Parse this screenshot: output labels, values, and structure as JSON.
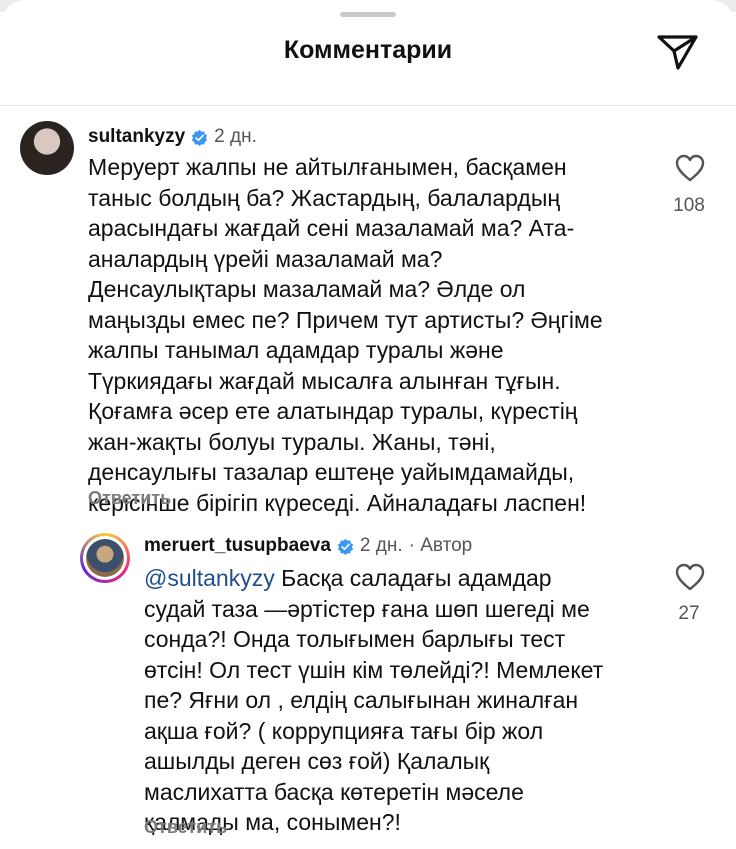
{
  "header": {
    "title": "Комментарии"
  },
  "comments": [
    {
      "username": "sultankyzy",
      "time": "2 дн.",
      "text": "Меруерт жалпы не айтылғанымен, басқамен\nтаныс болдың ба? Жастардың, балалардың\nарасындағы жағдай сені мазаламай ма? Ата-\nаналардың үрейі мазаламай ма?\nДенсаулықтары мазаламай ма? Әлде ол\nмаңызды емес пе? Причем тут артисты? Әңгіме\nжалпы танымал адамдар туралы және\nТүркиядағы жағдай мысалға алынған тұғын.\nҚоғамға әсер ете алатындар туралы, күрестің\nжан-жақты болуы туралы. Жаны, тәні,\nденсаулығы тазалар ештеңе уайымдамайды,\nкерісінше бірігіп күреседі. Айналадағы ласпен!",
      "likes": "108",
      "reply_label": "Ответить"
    },
    {
      "username": "meruert_tusupbaeva",
      "time": "2 дн.",
      "author_tag": "· Автор",
      "mention": "@sultankyzy",
      "text": "Басқа саладағы адамдар\nсудай таза —әртістер ғана шөп шегеді ме\nсонда?! Онда толығымен барлығы тест\nөтсін! Ол тест үшін кім төлейді?! Мемлекет\nпе? Яғни ол , елдің салығынан жиналған\nақша ғой? ( коррупцияға тағы бір жол\nашылды деген сөз ғой) Қалалық\nмаслихатта басқа көтеретін мәселе\nқалмады ма, сонымен?!",
      "likes": "27",
      "reply_label": "Ответить"
    }
  ],
  "colors": {
    "verified": "#3897f0",
    "mention": "#1f4e8c",
    "secondary_text": "#555555",
    "reply_link": "#7c7c7c"
  },
  "icons": [
    "share-icon",
    "verified-badge-icon",
    "heart-icon"
  ]
}
